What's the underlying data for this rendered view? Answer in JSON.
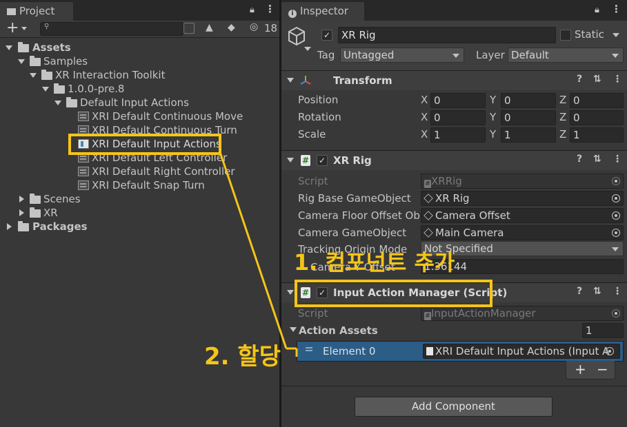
{
  "project": {
    "tab_title": "Project",
    "hidden_count": "18",
    "tree": [
      {
        "label": "Assets",
        "bold": true
      },
      {
        "label": "Samples"
      },
      {
        "label": "XR Interaction Toolkit"
      },
      {
        "label": "1.0.0-pre.8"
      },
      {
        "label": "Default Input Actions"
      },
      {
        "label": "XRI Default Continuous Move"
      },
      {
        "label": "XRI Default Continuous Turn"
      },
      {
        "label": "XRI Default Input Actions"
      },
      {
        "label": "XRI Default Left Controller"
      },
      {
        "label": "XRI Default Right Controller"
      },
      {
        "label": "XRI Default Snap Turn"
      },
      {
        "label": "Scenes"
      },
      {
        "label": "XR"
      },
      {
        "label": "Packages",
        "bold": true
      }
    ]
  },
  "inspector": {
    "tab_title": "Inspector",
    "object_name": "XR Rig",
    "static_label": "Static",
    "tag_label": "Tag",
    "tag_value": "Untagged",
    "layer_label": "Layer",
    "layer_value": "Default",
    "transform": {
      "title": "Transform",
      "rows": [
        {
          "label": "Position",
          "x": "0",
          "y": "0",
          "z": "0"
        },
        {
          "label": "Rotation",
          "x": "0",
          "y": "0",
          "z": "0"
        },
        {
          "label": "Scale",
          "x": "1",
          "y": "1",
          "z": "1"
        }
      ],
      "axis_x": "X",
      "axis_y": "Y",
      "axis_z": "Z"
    },
    "xr_rig": {
      "title": "XR Rig",
      "script_label": "Script",
      "script_value": "XRRig",
      "rig_base_label": "Rig Base GameObject",
      "rig_base_value": "XR Rig",
      "cam_floor_label": "Camera Floor Offset Obje",
      "cam_floor_value": "Camera Offset",
      "cam_go_label": "Camera GameObject",
      "cam_go_value": "Main Camera",
      "tracking_label": "Tracking Origin Mode",
      "tracking_value": "Not Specified",
      "cam_y_label": "Camera Y Offset",
      "cam_y_value": "1.36144"
    },
    "iam": {
      "title": "Input Action Manager (Script)",
      "script_label": "Script",
      "script_value": "InputActionManager",
      "assets_label": "Action Assets",
      "assets_count": "1",
      "element_label": "Element 0",
      "element_value": "XRI Default Input Actions (Input A"
    },
    "add_component": "Add Component",
    "plus": "+",
    "minus": "−"
  },
  "annotations": {
    "step1": "1. 컴포넌트 추가",
    "step2": "2. 할당"
  },
  "colors": {
    "annotation": "#f5c518",
    "selection": "#2c5d87",
    "panel": "#383838"
  }
}
